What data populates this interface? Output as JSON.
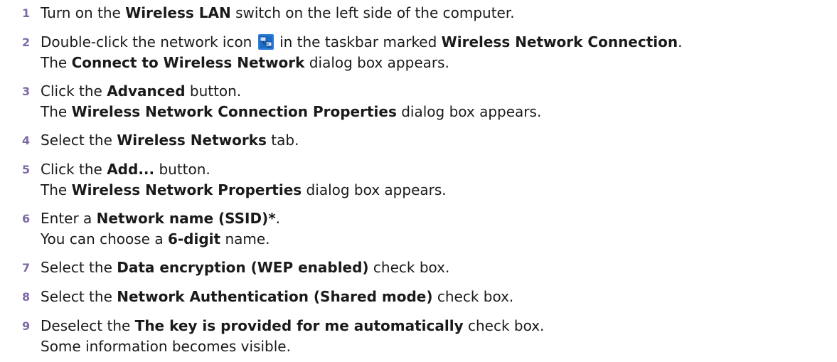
{
  "icons": {
    "network_icon": "network-connection-icon"
  },
  "steps": [
    {
      "num": "1",
      "a": "Turn on the ",
      "b": "Wireless LAN",
      "c": " switch on the left side of the computer."
    },
    {
      "num": "2",
      "a": "Double-click the network icon ",
      "b_pre": " in the taskbar marked ",
      "b": "Wireless Network Connection",
      "c": ".",
      "l2a": "The ",
      "l2b": "Connect to Wireless Network",
      "l2c": " dialog box appears."
    },
    {
      "num": "3",
      "a": "Click the ",
      "b": "Advanced",
      "c": " button.",
      "l2a": "The ",
      "l2b": "Wireless Network Connection Properties",
      "l2c": " dialog box appears."
    },
    {
      "num": "4",
      "a": "Select the ",
      "b": "Wireless Networks",
      "c": " tab."
    },
    {
      "num": "5",
      "a": "Click the ",
      "b": "Add...",
      "c": " button.",
      "l2a": "The ",
      "l2b": "Wireless Network Properties",
      "l2c": " dialog box appears."
    },
    {
      "num": "6",
      "a": "Enter a ",
      "b": "Network name (SSID)*",
      "c": ".",
      "l2a": "You can choose a ",
      "l2b": "6-digit",
      "l2c": " name."
    },
    {
      "num": "7",
      "a": "Select the ",
      "b": "Data encryption (WEP enabled)",
      "c": " check box."
    },
    {
      "num": "8",
      "a": "Select the ",
      "b": "Network Authentication (Shared mode)",
      "c": " check box."
    },
    {
      "num": "9",
      "a": "Deselect the ",
      "b": "The key is provided for me automatically",
      "c": " check box.",
      "l2": "Some information becomes visible."
    }
  ]
}
